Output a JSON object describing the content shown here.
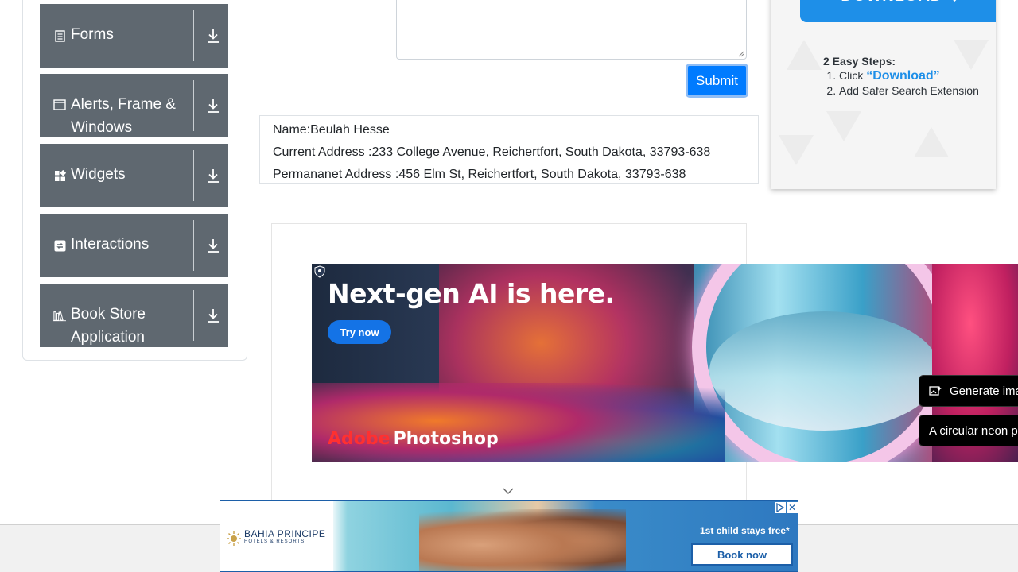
{
  "sidebar": {
    "groups": [
      {
        "label": "Forms",
        "icon": "document-icon"
      },
      {
        "label": "Alerts, Frame & Windows",
        "icon": "window-icon"
      },
      {
        "label": "Widgets",
        "icon": "widgets-icon"
      },
      {
        "label": "Interactions",
        "icon": "interactions-icon"
      },
      {
        "label": "Book Store Application",
        "icon": "books-icon"
      }
    ]
  },
  "form": {
    "submit_label": "Submit"
  },
  "output": {
    "name": "Name:Beulah Hesse",
    "current_address": "Current Address :233 College Avenue, Reichertfort, South Dakota, 33793-638",
    "permanent_address": "Permananet Address :456 Elm St, Reichertfort, South Dakota, 33793-638"
  },
  "download_ad": {
    "button_label": "DOWNLOAD ⇩",
    "steps_title": "2 Easy Steps:",
    "step1_prefix": "Click ",
    "step1_link": "“Download”",
    "step2": "Add Safer Search Extension"
  },
  "photoshop_ad": {
    "headline": "Next-gen AI is here.",
    "try_label": "Try now",
    "brand_adobe": "Adobe",
    "brand_product": "Photoshop",
    "pill1": "Generate ima",
    "pill2": "A circular neon p"
  },
  "bahia_ad": {
    "logo_line1": "BAHIA PRINCIPE",
    "logo_line2": "HOTELS & RESORTS",
    "promo": "1st child stays free*",
    "book_label": "Book now",
    "close_glyph": "✕"
  },
  "colors": {
    "sidebar_group_bg": "#5f6870",
    "primary": "#007bff",
    "download_blue": "#1e8fe8"
  }
}
